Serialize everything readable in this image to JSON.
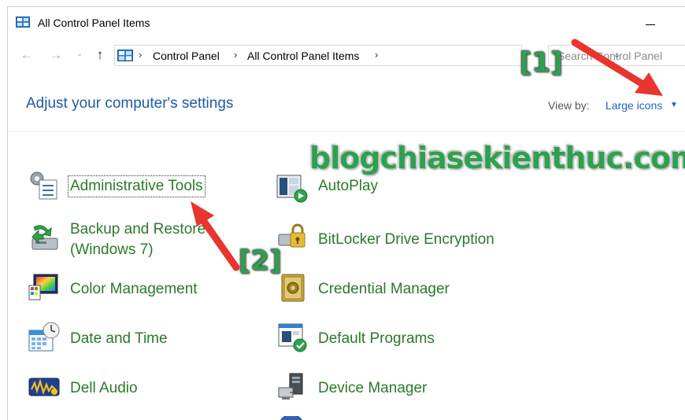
{
  "window": {
    "title": "All Control Panel Items"
  },
  "navigation": {
    "back_glyph": "←",
    "forward_glyph": "→",
    "recent_glyph": "⌄",
    "up_glyph": "↑",
    "breadcrumb": [
      "Control Panel",
      "All Control Panel Items"
    ],
    "crumb_separator": "›",
    "dropdown_glyph": "⌄",
    "search_placeholder": "Search Control Panel"
  },
  "header": {
    "title": "Adjust your computer's settings",
    "view_by_label": "View by:",
    "view_by_value": "Large icons",
    "view_by_caret": "▼"
  },
  "items": {
    "left": [
      {
        "label": "Administrative Tools",
        "icon": "administrative-tools-icon",
        "selected": true
      },
      {
        "label_line1": "Backup and Restore",
        "label_line2": "(Windows 7)",
        "icon": "backup-restore-icon"
      },
      {
        "label": "Color Management",
        "icon": "color-management-icon"
      },
      {
        "label": "Date and Time",
        "icon": "date-time-icon"
      },
      {
        "label": "Dell Audio",
        "icon": "dell-audio-icon"
      }
    ],
    "right": [
      {
        "label": "AutoPlay",
        "icon": "autoplay-icon"
      },
      {
        "label": "BitLocker Drive Encryption",
        "icon": "bitlocker-icon"
      },
      {
        "label": "Credential Manager",
        "icon": "credential-manager-icon"
      },
      {
        "label": "Default Programs",
        "icon": "default-programs-icon"
      },
      {
        "label": "Device Manager",
        "icon": "device-manager-icon"
      }
    ]
  },
  "annotations": {
    "watermark": "blogchiasekienthuc.com",
    "note1": "[1]",
    "note2": "[2]",
    "arrow_color": "#e8352e"
  },
  "colors": {
    "item_text": "#2a7a2a",
    "title_blue": "#1e5aa8",
    "link_blue": "#1e64c8"
  }
}
